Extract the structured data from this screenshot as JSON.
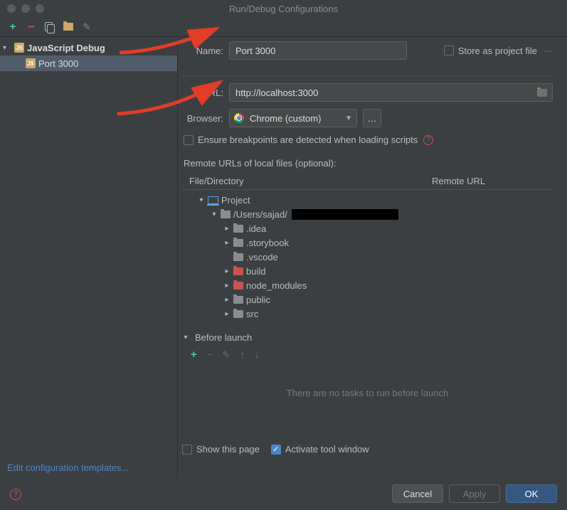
{
  "window": {
    "title": "Run/Debug Configurations"
  },
  "sidebar": {
    "root_label": "JavaScript Debug",
    "child_label": "Port 3000"
  },
  "form": {
    "name_label": "Name:",
    "name_value": "Port 3000",
    "store_label": "Store as project file",
    "url_label": "URL:",
    "url_value": "http://localhost:3000",
    "browser_label": "Browser:",
    "browser_value": "Chrome (custom)",
    "ensure_bp_label": "Ensure breakpoints are detected when loading scripts",
    "remote_urls_label": "Remote URLs of local files (optional):"
  },
  "table": {
    "col_file": "File/Directory",
    "col_remote": "Remote URL"
  },
  "tree": {
    "project": "Project",
    "root_path": "/Users/sajad/",
    "idea": ".idea",
    "storybook": ".storybook",
    "vscode": ".vscode",
    "build": "build",
    "node_modules": "node_modules",
    "public": "public",
    "src": "src"
  },
  "before_launch": {
    "label": "Before launch",
    "empty": "There are no tasks to run before launch"
  },
  "footer": {
    "show_page": "Show this page",
    "activate_tool": "Activate tool window",
    "edit_templates": "Edit configuration templates...",
    "cancel": "Cancel",
    "apply": "Apply",
    "ok": "OK"
  }
}
